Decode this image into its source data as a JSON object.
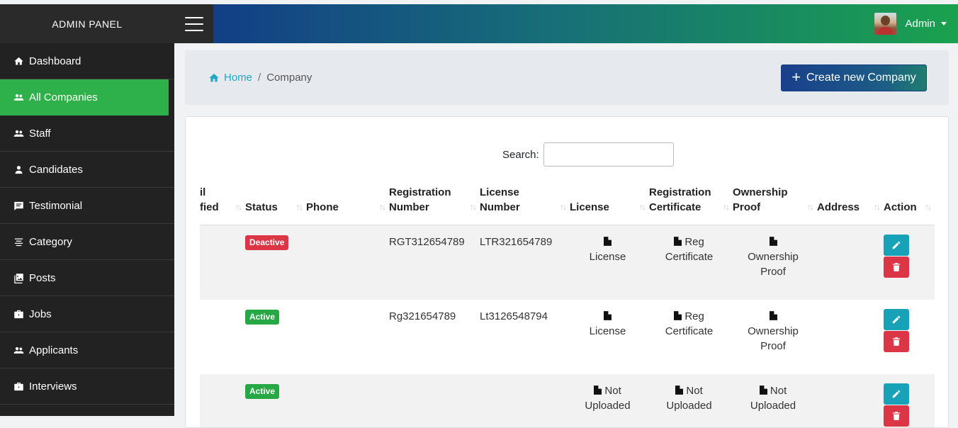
{
  "brand": "ADMIN PANEL",
  "user": {
    "name": "Admin"
  },
  "sidebar": {
    "items": [
      {
        "label": "Dashboard",
        "icon": "home-icon",
        "active": false
      },
      {
        "label": "All Companies",
        "icon": "users-icon",
        "active": true
      },
      {
        "label": "Staff",
        "icon": "users-icon",
        "active": false
      },
      {
        "label": "Candidates",
        "icon": "user-icon",
        "active": false
      },
      {
        "label": "Testimonial",
        "icon": "comment-icon",
        "active": false
      },
      {
        "label": "Category",
        "icon": "list-icon",
        "active": false
      },
      {
        "label": "Posts",
        "icon": "image-icon",
        "active": false
      },
      {
        "label": "Jobs",
        "icon": "briefcase-icon",
        "active": false
      },
      {
        "label": "Applicants",
        "icon": "users-icon",
        "active": false
      },
      {
        "label": "Interviews",
        "icon": "briefcase-icon",
        "active": false
      }
    ]
  },
  "breadcrumb": {
    "home": "Home",
    "separator": "/",
    "current": "Company"
  },
  "create_button": {
    "plus": "+",
    "label": "Create new Company"
  },
  "search": {
    "label": "Search:",
    "value": ""
  },
  "table": {
    "columns": [
      {
        "line1": "il",
        "line2": "fied"
      },
      {
        "line1": "",
        "line2": "Status"
      },
      {
        "line1": "",
        "line2": "Phone"
      },
      {
        "line1": "Registration",
        "line2": "Number"
      },
      {
        "line1": "License",
        "line2": "Number"
      },
      {
        "line1": "",
        "line2": "License"
      },
      {
        "line1": "Registration",
        "line2": "Certificate"
      },
      {
        "line1": "Ownership",
        "line2": "Proof"
      },
      {
        "line1": "",
        "line2": "Address"
      },
      {
        "line1": "",
        "line2": "Action"
      }
    ],
    "sort_glyph": "↑↓",
    "rows": [
      {
        "status": "Deactive",
        "status_color": "#dc3545",
        "phone": "",
        "reg_number": "RGT312654789",
        "license_number": "LTR321654789",
        "license": [
          "License"
        ],
        "reg_cert": [
          "Reg",
          "Certificate"
        ],
        "ownership": [
          "Ownership",
          "Proof"
        ],
        "address": ""
      },
      {
        "status": "Active",
        "status_color": "#28a745",
        "phone": "",
        "reg_number": "Rg321654789",
        "license_number": "Lt3126548794",
        "license": [
          "License"
        ],
        "reg_cert": [
          "Reg",
          "Certificate"
        ],
        "ownership": [
          "Ownership",
          "Proof"
        ],
        "address": ""
      },
      {
        "status": "Active",
        "status_color": "#28a745",
        "phone": "",
        "reg_number": "",
        "license_number": "",
        "license": [
          "Not",
          "Uploaded"
        ],
        "reg_cert": [
          "Not",
          "Uploaded"
        ],
        "ownership": [
          "Not",
          "Uploaded"
        ],
        "address": ""
      }
    ]
  },
  "colors": {
    "sidebar_active": "#2eb14a",
    "edit": "#17a2b8",
    "delete": "#dc3545"
  }
}
